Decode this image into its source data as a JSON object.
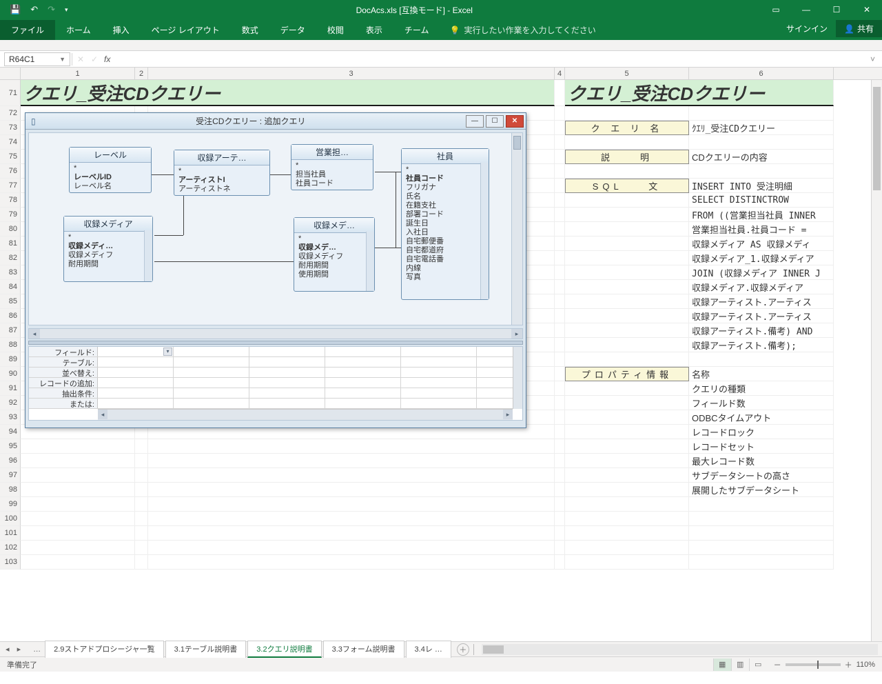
{
  "titlebar": {
    "title": "DocAcs.xls [互換モード] - Excel"
  },
  "qat": {
    "save": "💾",
    "undo": "↶",
    "redo": "↷",
    "more": "▾"
  },
  "winctrl": {
    "opts": "▭",
    "min": "—",
    "max": "☐",
    "close": "✕"
  },
  "ribbon": {
    "file": "ファイル",
    "home": "ホーム",
    "insert": "挿入",
    "layout": "ページ レイアウト",
    "formula": "数式",
    "data": "データ",
    "review": "校閲",
    "view": "表示",
    "team": "チーム",
    "tell_icon": "💡",
    "tell": "実行したい作業を入力してください",
    "signin": "サインイン",
    "share_icon": "👤",
    "share": "共有"
  },
  "fbar": {
    "name": "R64C1",
    "cancel": "✕",
    "ok": "✓",
    "fx": "fx",
    "expand": "˅"
  },
  "cols": {
    "c1": "1",
    "c2": "2",
    "c3": "3",
    "c4": "4",
    "c5": "5",
    "c6": "6"
  },
  "rownums": [
    "71",
    "72",
    "73",
    "74",
    "75",
    "76",
    "77",
    "78",
    "79",
    "80",
    "81",
    "82",
    "83",
    "84",
    "85",
    "86",
    "87",
    "88",
    "89",
    "90",
    "91",
    "92",
    "93",
    "94",
    "95",
    "96",
    "97",
    "98",
    "99",
    "100",
    "101",
    "102",
    "103"
  ],
  "main": {
    "h1_left": "クエリ_受注CDクエリー",
    "h1_right": "クエリ_受注CDクエリー",
    "labels": {
      "name": "ク エ リ 名",
      "desc": "説　　明",
      "sql": "SQL　　文",
      "prop": "プロパティ情報"
    },
    "vals": {
      "name": "ｸｴﾘ_受注CDクエリー",
      "desc": "CDクエリーの内容",
      "sql": [
        "INSERT INTO 受注明細",
        "SELECT DISTINCTROW",
        "FROM ((営業担当社員 INNER",
        "営業担当社員.社員コード =",
        "収録メディア AS 収録メディ",
        "収録メディア_1.収録メディア",
        "JOIN (収録メディア INNER J",
        "収録メディア.収録メディア",
        "収録アーティスト.アーティス",
        "収録アーティスト.アーティス",
        "収録アーティスト.備考) AND",
        "収録アーティスト.備考);"
      ],
      "props": [
        "名称",
        "クエリの種類",
        "フィールド数",
        "ODBCタイムアウト",
        "レコードロック",
        "レコードセット",
        "最大レコード数",
        "サブデータシートの高さ",
        "展開したサブデータシート"
      ]
    }
  },
  "floatwin": {
    "icon": "▯",
    "title": "受注CDクエリー : 追加クエリ",
    "win": {
      "min": "—",
      "max": "☐",
      "close": "✕"
    },
    "tables": {
      "label": {
        "title": "レーベル",
        "rows": [
          "*",
          "レーベルID",
          "レーベル名"
        ],
        "bold": [
          1
        ]
      },
      "artist": {
        "title": "収録アーテ…",
        "rows": [
          "*",
          "アーティストI",
          "アーティストネ"
        ],
        "bold": [
          1
        ]
      },
      "media": {
        "title": "収録メディア",
        "rows": [
          "*",
          "収録メディ…",
          "収録メディフ",
          "耐用期間"
        ],
        "bold": [
          1
        ]
      },
      "sales": {
        "title": "営業担…",
        "rows": [
          "*",
          "担当社員",
          "社員コード"
        ],
        "bold": []
      },
      "media2": {
        "title": "収録メデ…",
        "rows": [
          "*",
          "収録メデ…",
          "収録メディフ",
          "耐用期間",
          "使用期間"
        ],
        "bold": [
          1
        ]
      },
      "emp": {
        "title": "社員",
        "rows": [
          "*",
          "社員コード",
          "フリガナ",
          "氏名",
          "在籍支社",
          "部署コード",
          "誕生日",
          "入社日",
          "自宅郵便番",
          "自宅都道府",
          "自宅電話番",
          "内線",
          "写真"
        ],
        "bold": [
          1
        ]
      }
    },
    "qgrid": {
      "labels": [
        "フィールド:",
        "テーブル:",
        "並べ替え:",
        "レコードの追加:",
        "抽出条件:",
        "または:"
      ]
    }
  },
  "sheets": {
    "nav": "◂ ▸",
    "dots": "…",
    "tabs": [
      "2.9ストアドプロシージャ一覧",
      "3.1テーブル説明書",
      "3.2クエリ説明書",
      "3.3フォーム説明書",
      "3.4レ …"
    ],
    "active": 2,
    "plus": "＋"
  },
  "status": {
    "ready": "準備完了",
    "zoom": "110%",
    "minus": "－",
    "plus": "＋"
  }
}
